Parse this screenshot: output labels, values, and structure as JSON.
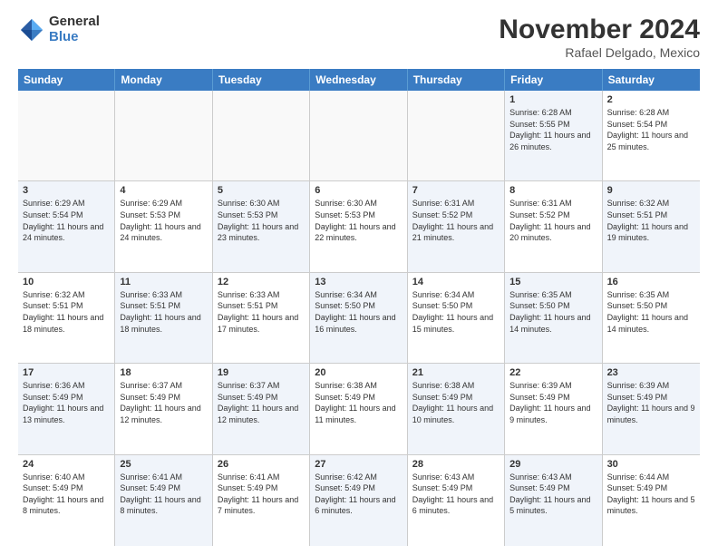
{
  "logo": {
    "general": "General",
    "blue": "Blue"
  },
  "header": {
    "month": "November 2024",
    "location": "Rafael Delgado, Mexico"
  },
  "weekdays": [
    "Sunday",
    "Monday",
    "Tuesday",
    "Wednesday",
    "Thursday",
    "Friday",
    "Saturday"
  ],
  "rows": [
    [
      {
        "day": "",
        "text": "",
        "empty": true
      },
      {
        "day": "",
        "text": "",
        "empty": true
      },
      {
        "day": "",
        "text": "",
        "empty": true
      },
      {
        "day": "",
        "text": "",
        "empty": true
      },
      {
        "day": "",
        "text": "",
        "empty": true
      },
      {
        "day": "1",
        "text": "Sunrise: 6:28 AM\nSunset: 5:55 PM\nDaylight: 11 hours and 26 minutes.",
        "alt": true
      },
      {
        "day": "2",
        "text": "Sunrise: 6:28 AM\nSunset: 5:54 PM\nDaylight: 11 hours and 25 minutes.",
        "alt": false
      }
    ],
    [
      {
        "day": "3",
        "text": "Sunrise: 6:29 AM\nSunset: 5:54 PM\nDaylight: 11 hours and 24 minutes.",
        "alt": true
      },
      {
        "day": "4",
        "text": "Sunrise: 6:29 AM\nSunset: 5:53 PM\nDaylight: 11 hours and 24 minutes.",
        "alt": false
      },
      {
        "day": "5",
        "text": "Sunrise: 6:30 AM\nSunset: 5:53 PM\nDaylight: 11 hours and 23 minutes.",
        "alt": true
      },
      {
        "day": "6",
        "text": "Sunrise: 6:30 AM\nSunset: 5:53 PM\nDaylight: 11 hours and 22 minutes.",
        "alt": false
      },
      {
        "day": "7",
        "text": "Sunrise: 6:31 AM\nSunset: 5:52 PM\nDaylight: 11 hours and 21 minutes.",
        "alt": true
      },
      {
        "day": "8",
        "text": "Sunrise: 6:31 AM\nSunset: 5:52 PM\nDaylight: 11 hours and 20 minutes.",
        "alt": false
      },
      {
        "day": "9",
        "text": "Sunrise: 6:32 AM\nSunset: 5:51 PM\nDaylight: 11 hours and 19 minutes.",
        "alt": true
      }
    ],
    [
      {
        "day": "10",
        "text": "Sunrise: 6:32 AM\nSunset: 5:51 PM\nDaylight: 11 hours and 18 minutes.",
        "alt": false
      },
      {
        "day": "11",
        "text": "Sunrise: 6:33 AM\nSunset: 5:51 PM\nDaylight: 11 hours and 18 minutes.",
        "alt": true
      },
      {
        "day": "12",
        "text": "Sunrise: 6:33 AM\nSunset: 5:51 PM\nDaylight: 11 hours and 17 minutes.",
        "alt": false
      },
      {
        "day": "13",
        "text": "Sunrise: 6:34 AM\nSunset: 5:50 PM\nDaylight: 11 hours and 16 minutes.",
        "alt": true
      },
      {
        "day": "14",
        "text": "Sunrise: 6:34 AM\nSunset: 5:50 PM\nDaylight: 11 hours and 15 minutes.",
        "alt": false
      },
      {
        "day": "15",
        "text": "Sunrise: 6:35 AM\nSunset: 5:50 PM\nDaylight: 11 hours and 14 minutes.",
        "alt": true
      },
      {
        "day": "16",
        "text": "Sunrise: 6:35 AM\nSunset: 5:50 PM\nDaylight: 11 hours and 14 minutes.",
        "alt": false
      }
    ],
    [
      {
        "day": "17",
        "text": "Sunrise: 6:36 AM\nSunset: 5:49 PM\nDaylight: 11 hours and 13 minutes.",
        "alt": true
      },
      {
        "day": "18",
        "text": "Sunrise: 6:37 AM\nSunset: 5:49 PM\nDaylight: 11 hours and 12 minutes.",
        "alt": false
      },
      {
        "day": "19",
        "text": "Sunrise: 6:37 AM\nSunset: 5:49 PM\nDaylight: 11 hours and 12 minutes.",
        "alt": true
      },
      {
        "day": "20",
        "text": "Sunrise: 6:38 AM\nSunset: 5:49 PM\nDaylight: 11 hours and 11 minutes.",
        "alt": false
      },
      {
        "day": "21",
        "text": "Sunrise: 6:38 AM\nSunset: 5:49 PM\nDaylight: 11 hours and 10 minutes.",
        "alt": true
      },
      {
        "day": "22",
        "text": "Sunrise: 6:39 AM\nSunset: 5:49 PM\nDaylight: 11 hours and 9 minutes.",
        "alt": false
      },
      {
        "day": "23",
        "text": "Sunrise: 6:39 AM\nSunset: 5:49 PM\nDaylight: 11 hours and 9 minutes.",
        "alt": true
      }
    ],
    [
      {
        "day": "24",
        "text": "Sunrise: 6:40 AM\nSunset: 5:49 PM\nDaylight: 11 hours and 8 minutes.",
        "alt": false
      },
      {
        "day": "25",
        "text": "Sunrise: 6:41 AM\nSunset: 5:49 PM\nDaylight: 11 hours and 8 minutes.",
        "alt": true
      },
      {
        "day": "26",
        "text": "Sunrise: 6:41 AM\nSunset: 5:49 PM\nDaylight: 11 hours and 7 minutes.",
        "alt": false
      },
      {
        "day": "27",
        "text": "Sunrise: 6:42 AM\nSunset: 5:49 PM\nDaylight: 11 hours and 6 minutes.",
        "alt": true
      },
      {
        "day": "28",
        "text": "Sunrise: 6:43 AM\nSunset: 5:49 PM\nDaylight: 11 hours and 6 minutes.",
        "alt": false
      },
      {
        "day": "29",
        "text": "Sunrise: 6:43 AM\nSunset: 5:49 PM\nDaylight: 11 hours and 5 minutes.",
        "alt": true
      },
      {
        "day": "30",
        "text": "Sunrise: 6:44 AM\nSunset: 5:49 PM\nDaylight: 11 hours and 5 minutes.",
        "alt": false
      }
    ]
  ]
}
